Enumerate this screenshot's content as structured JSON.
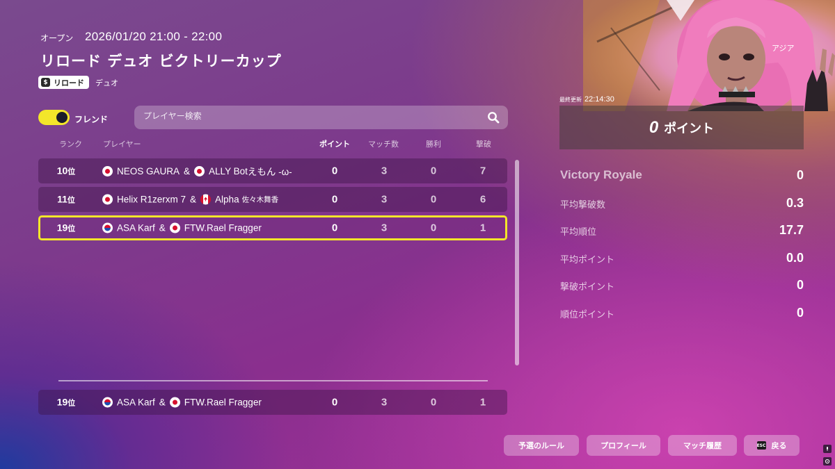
{
  "header": {
    "status": "オープン",
    "datetime": "2026/01/20 21:00 - 22:00",
    "title": "リロード デュオ ビクトリーカップ",
    "mode_tag": "リロード",
    "mode_sub": "デュオ"
  },
  "filters": {
    "friends_toggle_label": "フレンド",
    "friends_toggle_on": true,
    "search_placeholder": "プレイヤー検索"
  },
  "columns": {
    "rank": "ランク",
    "player": "プレイヤー",
    "points": "ポイント",
    "matches": "マッチ数",
    "wins": "勝利",
    "eliminations": "撃破"
  },
  "rows": [
    {
      "rank": "10",
      "rank_suffix": "位",
      "p1_flag": "jp",
      "p1": "NEOS GAURA",
      "p2_flag": "jp",
      "p2": "ALLY Bot",
      "p2_extra": "えもん -ω-",
      "points": "0",
      "matches": "3",
      "wins": "0",
      "elims": "7"
    },
    {
      "rank": "11",
      "rank_suffix": "位",
      "p1_flag": "jp",
      "p1": "Helix R1zerxm 7",
      "p2_flag": "ca",
      "p2": "Alpha",
      "p2_extra": "佐々木舞香",
      "points": "0",
      "matches": "3",
      "wins": "0",
      "elims": "6"
    },
    {
      "rank": "19",
      "rank_suffix": "位",
      "p1_flag": "kr",
      "p1": "ASA Karf",
      "p2_flag": "jp",
      "p2": "FTW.Rael Fragger",
      "p2_extra": "",
      "points": "0",
      "matches": "3",
      "wins": "0",
      "elims": "1"
    }
  ],
  "my_row": {
    "rank": "19",
    "rank_suffix": "位",
    "p1_flag": "kr",
    "p1": "ASA Karf",
    "p2_flag": "jp",
    "p2": "FTW.Rael Fragger",
    "points": "0",
    "matches": "3",
    "wins": "0",
    "elims": "1"
  },
  "panel": {
    "region": "アジア",
    "updated_label": "最終更新",
    "updated_time": "22:14:30",
    "points_value": "0",
    "points_label": "ポイント",
    "stats": [
      {
        "label": "Victory Royale",
        "value": "0"
      },
      {
        "label": "平均撃破数",
        "value": "0.3"
      },
      {
        "label": "平均順位",
        "value": "17.7"
      },
      {
        "label": "平均ポイント",
        "value": "0.0"
      },
      {
        "label": "撃破ポイント",
        "value": "0"
      },
      {
        "label": "順位ポイント",
        "value": "0"
      }
    ]
  },
  "buttons": {
    "rules": "予選のルール",
    "profile": "プロフィール",
    "match_history": "マッチ履歴",
    "back": "戻る",
    "esc_key": "ESC"
  },
  "colors": {
    "accent_yellow": "#f3e62a",
    "character_hair": "#e96fb4"
  }
}
